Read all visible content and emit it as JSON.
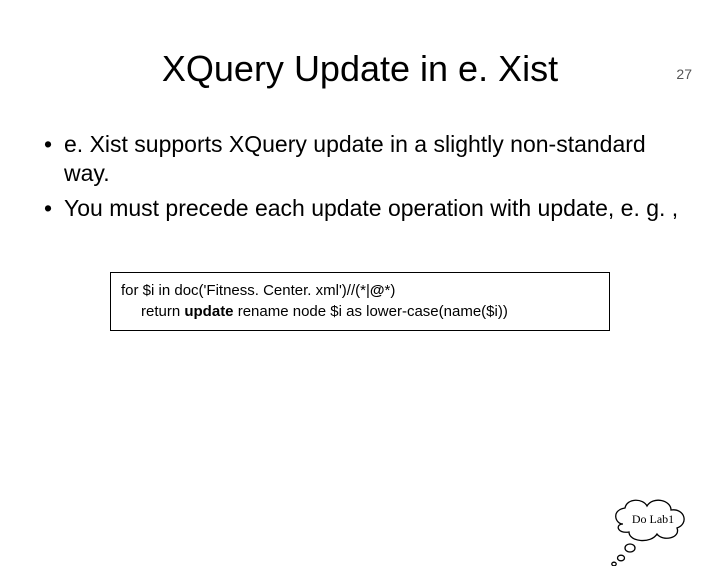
{
  "page_number": "27",
  "title": "XQuery Update in e. Xist",
  "bullets": [
    "e. Xist supports XQuery update in a slightly non-standard way.",
    "You must precede each update operation with update, e. g. ,"
  ],
  "code": {
    "line1_pre": "for $i in doc('Fitness. Center. xml')//(*|",
    "line1_at": "@",
    "line1_post": "*)",
    "line2_pre": "return ",
    "line2_bold": "update",
    "line2_post": " rename node $i as lower-case(name($i))"
  },
  "callout": "Do Lab1"
}
